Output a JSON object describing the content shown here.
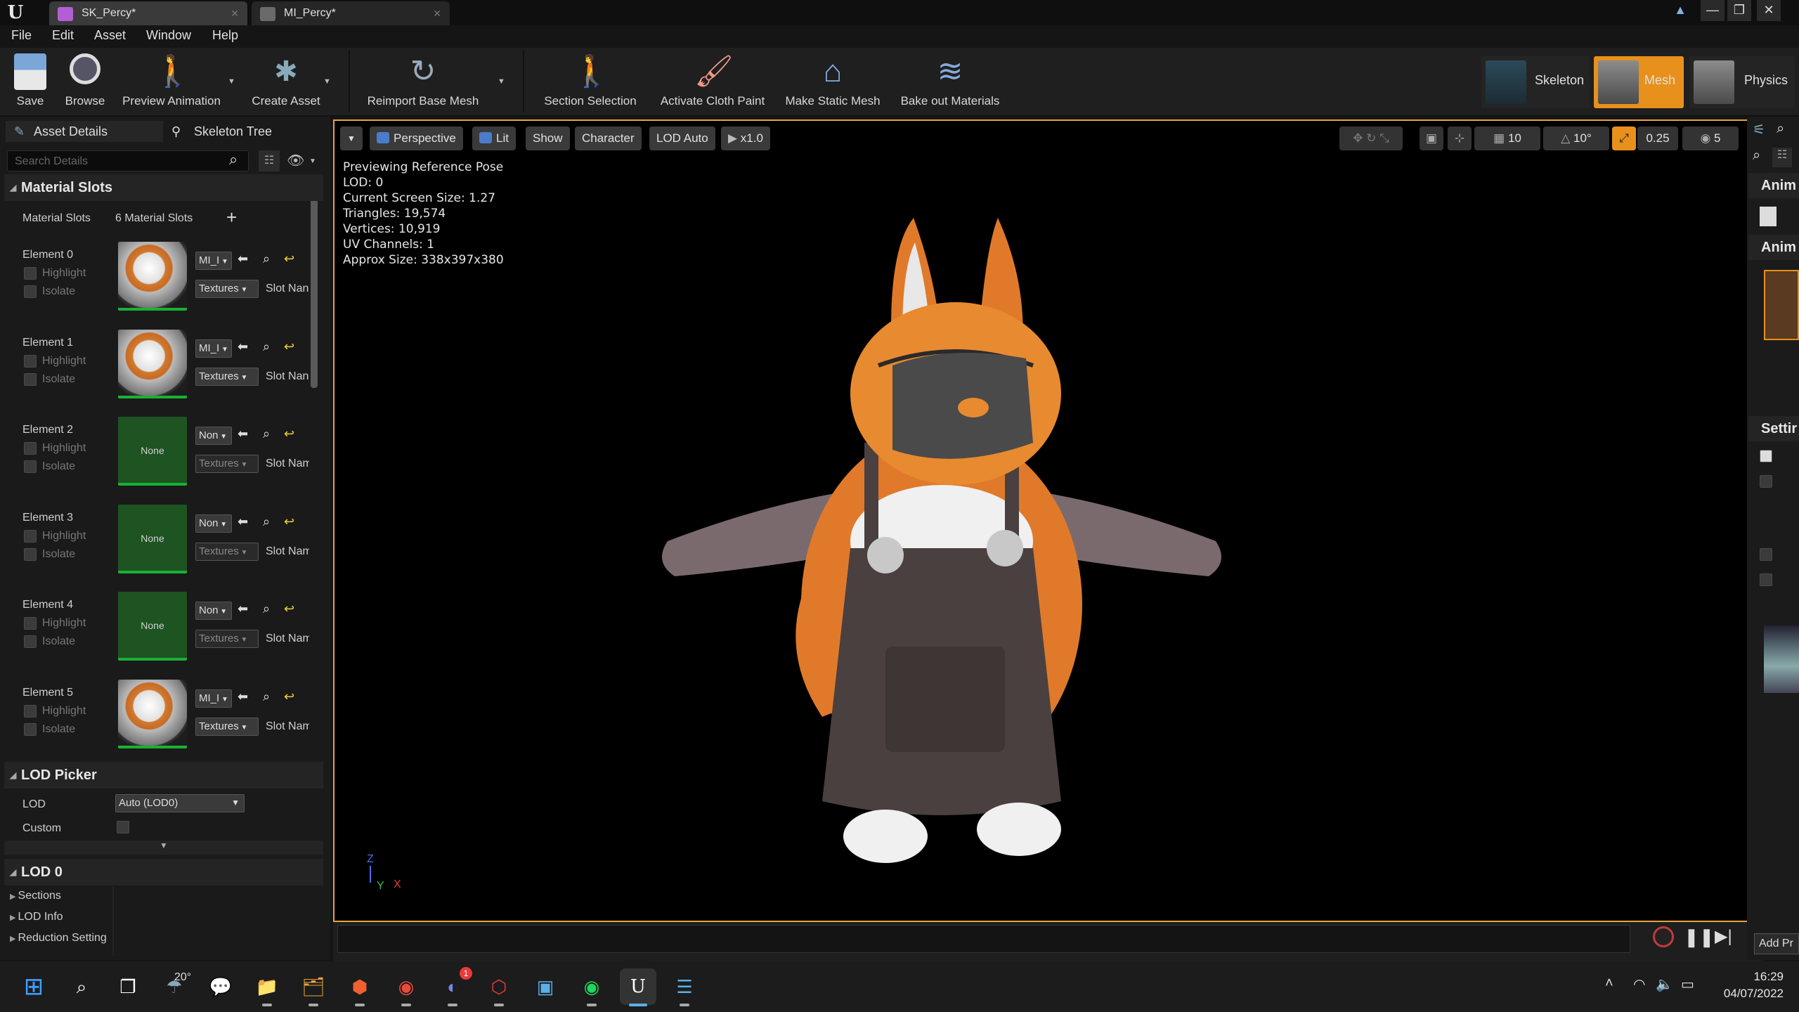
{
  "window": {
    "tabs": [
      {
        "label": "SK_Percy*"
      },
      {
        "label": "MI_Percy*"
      }
    ]
  },
  "menu": [
    "File",
    "Edit",
    "Asset",
    "Window",
    "Help"
  ],
  "toolbar": {
    "buttons": [
      {
        "label": "Save"
      },
      {
        "label": "Browse"
      },
      {
        "label": "Preview Animation"
      },
      {
        "label": "Create Asset"
      },
      {
        "label": "Reimport Base Mesh"
      },
      {
        "label": "Section Selection"
      },
      {
        "label": "Activate Cloth Paint"
      },
      {
        "label": "Make Static Mesh"
      },
      {
        "label": "Bake out Materials"
      }
    ],
    "modes": [
      {
        "label": "Skeleton"
      },
      {
        "label": "Mesh"
      },
      {
        "label": "Physics"
      }
    ]
  },
  "left_panel": {
    "tabs": [
      "Asset Details",
      "Skeleton Tree"
    ],
    "search_placeholder": "Search Details",
    "material_slots": {
      "header": "Material Slots",
      "row_label": "Material Slots",
      "count": "6 Material Slots",
      "highlight_label": "Highlight",
      "isolate_label": "Isolate",
      "slot_name_label": "Slot Name",
      "textures_label": "Textures",
      "none_label": "None",
      "elements": [
        {
          "label": "Element 0",
          "material": "MI_I",
          "slot_name": "Slot Nan"
        },
        {
          "label": "Element 1",
          "material": "MI_I",
          "slot_name": "Slot Nan"
        },
        {
          "label": "Element 2",
          "material": "Non",
          "slot_name": "Slot Name"
        },
        {
          "label": "Element 3",
          "material": "Non",
          "slot_name": "Slot Name"
        },
        {
          "label": "Element 4",
          "material": "Non",
          "slot_name": "Slot Name"
        },
        {
          "label": "Element 5",
          "material": "MI_I",
          "slot_name": "Slot Name"
        }
      ]
    },
    "lod_picker": {
      "header": "LOD Picker",
      "lod_label": "LOD",
      "lod_value": "Auto (LOD0)",
      "custom_label": "Custom"
    },
    "lod0": {
      "header": "LOD 0",
      "items": [
        "Sections",
        "LOD Info",
        "Reduction Setting"
      ]
    }
  },
  "viewport": {
    "toolbar": {
      "perspective": "Perspective",
      "lit": "Lit",
      "show": "Show",
      "character": "Character",
      "lod": "LOD Auto",
      "speed": "x1.0",
      "grid_size": "10",
      "rotation_snap": "10°",
      "scale_snap": "0.25",
      "camera_speed": "5"
    },
    "stats": [
      "Previewing Reference Pose",
      "LOD: 0",
      "Current Screen Size: 1.27",
      "Triangles: 19,574",
      "Vertices: 10,919",
      "UV Channels: 1",
      "Approx Size: 338x397x380"
    ],
    "axis_labels": {
      "z": "Z",
      "y": "Y",
      "x": "X"
    }
  },
  "right_panel": {
    "headers": [
      "Anim",
      "Anim",
      "Settir"
    ],
    "add_button": "Add Pr"
  },
  "taskbar": {
    "weather": "20°",
    "discord_badge": "1",
    "time": "16:29",
    "date": "04/07/2022"
  },
  "colors": {
    "accent": "#e8a33c",
    "mode_active": "#e8901c",
    "none_thumb": "#1e5322",
    "none_bar": "#19b135"
  }
}
